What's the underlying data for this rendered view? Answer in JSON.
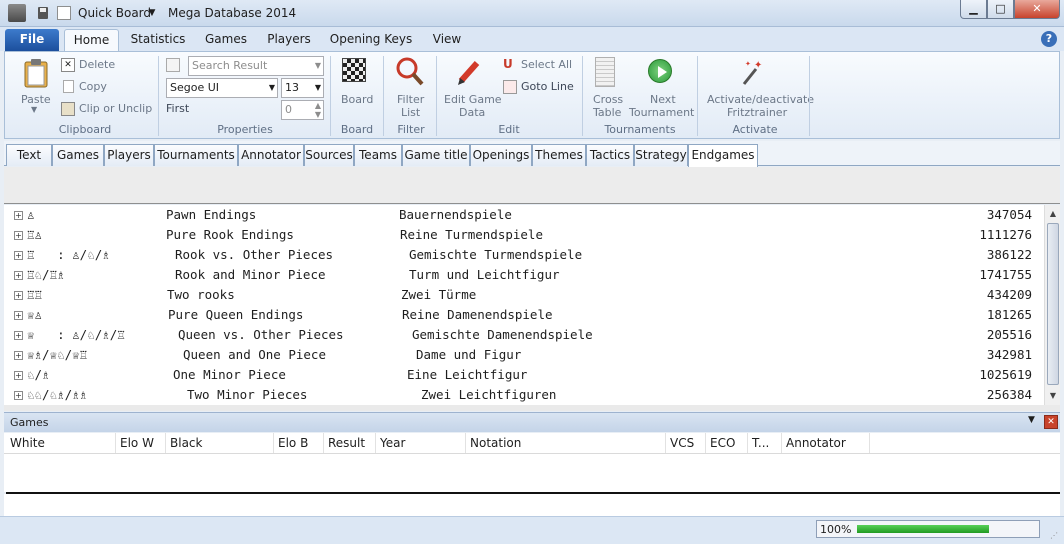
{
  "window": {
    "title": "Mega Database 2014",
    "quick_board_label": "Quick Board",
    "min_symbol": "▁",
    "max_symbol": "□",
    "close_symbol": "✕"
  },
  "ribbon_tabs": {
    "file": "File",
    "tabs": [
      "Home",
      "Statistics",
      "Games",
      "Players",
      "Opening Keys",
      "View"
    ],
    "active": "Home",
    "help": "?"
  },
  "ribbon": {
    "clipboard": {
      "label": "Clipboard",
      "paste": "Paste",
      "delete": "Delete",
      "copy": "Copy",
      "clip_or_unclip": "Clip or Unclip"
    },
    "properties": {
      "label": "Properties",
      "search_placeholder": "Search Result",
      "font": "Segoe UI",
      "font_size": "13",
      "first_label": "First",
      "first_value": "0"
    },
    "board": {
      "label": "Board",
      "button": "Board"
    },
    "filter": {
      "label": "Filter",
      "button_line1": "Filter",
      "button_line2": "List"
    },
    "edit": {
      "label": "Edit",
      "edit_game_line1": "Edit Game",
      "edit_game_line2": "Data",
      "select_all": "Select All",
      "goto_line": "Goto Line"
    },
    "tournaments": {
      "label": "Tournaments",
      "cross_table_line1": "Cross",
      "cross_table_line2": "Table",
      "next_tournament_line1": "Next",
      "next_tournament_line2": "Tournament"
    },
    "activate": {
      "label": "Activate",
      "button_line1": "Activate/deactivate",
      "button_line2": "Fritztrainer"
    }
  },
  "category_tabs": {
    "tabs": [
      "Text",
      "Games",
      "Players",
      "Tournaments",
      "Annotator",
      "Sources",
      "Teams",
      "Game title",
      "Openings",
      "Themes",
      "Tactics",
      "Strategy",
      "Endgames"
    ],
    "active": "Endgames"
  },
  "tree_rows": [
    {
      "code": "♙",
      "name": "Pawn Endings",
      "german": "Bauernendspiele",
      "count": "347054"
    },
    {
      "code": "♖♙",
      "name": "Pure Rook Endings",
      "german": "Reine Turmendspiele",
      "count": "1111276"
    },
    {
      "code": "♖   : ♙/♘/♗",
      "name": "Rook vs. Other Pieces",
      "german": "Gemischte Turmendspiele",
      "count": "386122"
    },
    {
      "code": "♖♘/♖♗",
      "name": "Rook and Minor Piece",
      "german": "Turm und Leichtfigur",
      "count": "1741755"
    },
    {
      "code": "♖♖",
      "name": "Two rooks",
      "german": "Zwei Türme",
      "count": "434209"
    },
    {
      "code": "♕♙",
      "name": "Pure Queen Endings",
      "german": "Reine Damenendspiele",
      "count": "181265"
    },
    {
      "code": "♕   : ♙/♘/♗/♖",
      "name": "Queen vs. Other Pieces",
      "german": "Gemischte Damenendspiele",
      "count": "205516"
    },
    {
      "code": "♕♗/♕♘/♕♖",
      "name": "Queen and One Piece",
      "german": "Dame und Figur",
      "count": "342981"
    },
    {
      "code": "♘/♗",
      "name": "One Minor Piece",
      "german": "Eine Leichtfigur",
      "count": "1025619"
    },
    {
      "code": "♘♘/♘♗/♗♗",
      "name": "Two Minor Pieces",
      "german": "Zwei Leichtfiguren",
      "count": "256384"
    }
  ],
  "games_pane": {
    "title": "Games",
    "columns": [
      "White",
      "Elo W",
      "Black",
      "Elo B",
      "Result",
      "Year",
      "Notation",
      "VCS",
      "ECO",
      "T...",
      "Annotator"
    ]
  },
  "status": {
    "progress_text": "100%",
    "progress_fraction": 1.0
  }
}
